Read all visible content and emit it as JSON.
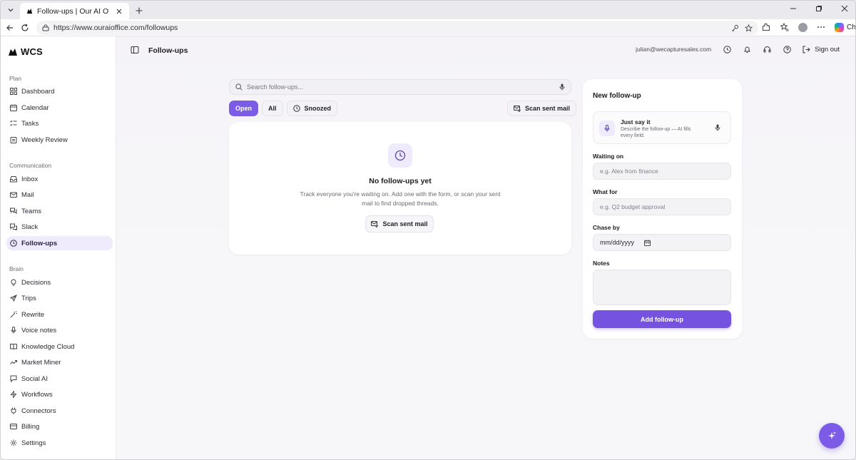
{
  "browser": {
    "tab_title": "Follow-ups | Our AI Office",
    "url": "https://www.ouraioffice.com/followups",
    "chat_label": "Chat"
  },
  "brand": {
    "name": "WCS"
  },
  "sidebar": {
    "sections": [
      {
        "label": "Plan",
        "items": [
          {
            "label": "Dashboard",
            "icon": "grid-icon"
          },
          {
            "label": "Calendar",
            "icon": "calendar-icon"
          },
          {
            "label": "Tasks",
            "icon": "list-check-icon"
          },
          {
            "label": "Weekly Review",
            "icon": "clipboard-icon"
          }
        ]
      },
      {
        "label": "Communication",
        "items": [
          {
            "label": "Inbox",
            "icon": "inbox-icon"
          },
          {
            "label": "Mail",
            "icon": "mail-icon"
          },
          {
            "label": "Teams",
            "icon": "chat-bubbles-icon"
          },
          {
            "label": "Slack",
            "icon": "hash-icon"
          },
          {
            "label": "Follow-ups",
            "icon": "clock-icon",
            "active": true
          }
        ]
      },
      {
        "label": "Brain",
        "items": [
          {
            "label": "Decisions",
            "icon": "lightbulb-icon"
          },
          {
            "label": "Trips",
            "icon": "plane-icon"
          },
          {
            "label": "Rewrite",
            "icon": "wand-icon"
          },
          {
            "label": "Voice notes",
            "icon": "mic-icon"
          },
          {
            "label": "Knowledge Cloud",
            "icon": "book-icon"
          },
          {
            "label": "Market Miner",
            "icon": "trend-icon"
          },
          {
            "label": "Social AI",
            "icon": "sparkle-chat-icon"
          },
          {
            "label": "Workflows",
            "icon": "workflow-icon"
          },
          {
            "label": "Connectors",
            "icon": "plug-icon"
          },
          {
            "label": "Billing",
            "icon": "card-icon"
          },
          {
            "label": "Settings",
            "icon": "gear-icon"
          }
        ]
      }
    ]
  },
  "header": {
    "title": "Follow-ups",
    "user_email": "julian@wecapturesales.com",
    "sign_out": "Sign out"
  },
  "search": {
    "placeholder": "Search follow-ups..."
  },
  "filters": [
    {
      "label": "Open",
      "active": true
    },
    {
      "label": "All"
    },
    {
      "label": "Snoozed",
      "icon": "clock-icon"
    }
  ],
  "scan_sent_mail": "Scan sent mail",
  "empty_state": {
    "title": "No follow-ups yet",
    "text": "Track everyone you're waiting on. Add one with the form, or scan your sent mail to find dropped threads.",
    "button": "Scan sent mail"
  },
  "form": {
    "title": "New follow-up",
    "just_say_it_title": "Just say it",
    "just_say_it_desc": "Describe the follow-up — AI fills every field.",
    "waiting_on_label": "Waiting on",
    "waiting_on_placeholder": "e.g. Alex from finance",
    "what_for_label": "What for",
    "what_for_placeholder": "e.g. Q2 budget approval",
    "chase_by_label": "Chase by",
    "chase_by_value": "mm/dd/yyyy",
    "notes_label": "Notes",
    "submit": "Add follow-up"
  },
  "colors": {
    "accent": "#7552e0",
    "accent_light": "#efeafc"
  }
}
